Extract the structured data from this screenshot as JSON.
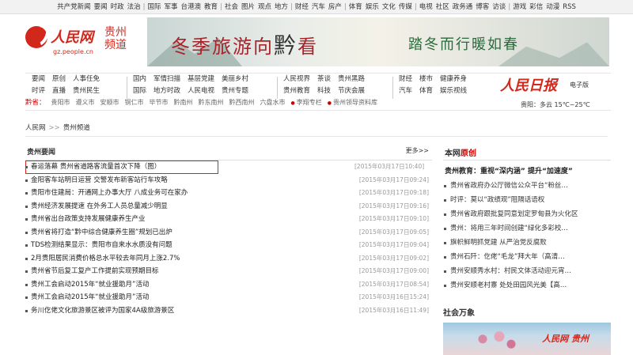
{
  "topnav": [
    "共产党新闻",
    "要闻",
    "时政",
    "法治",
    "国际",
    "军事",
    "台港澳",
    "教育",
    "社会",
    "图片",
    "观点",
    "地方",
    "财经",
    "汽车",
    "房产",
    "体育",
    "娱乐",
    "文化",
    "传媒",
    "电视",
    "社区",
    "政务通",
    "博客",
    "访谈",
    "游戏",
    "彩信",
    "动漫",
    "RSS"
  ],
  "topnav_groups": [
    [
      0,
      1,
      2,
      3
    ],
    [
      4,
      5,
      6,
      7
    ],
    [
      8,
      9,
      10,
      11
    ],
    [
      12,
      13,
      14
    ],
    [
      15,
      16,
      17,
      18
    ],
    [
      19,
      20,
      21,
      22,
      23
    ],
    [
      24,
      25,
      26,
      27
    ]
  ],
  "logo": {
    "name": "人民网",
    "domain": "gz.people.cn",
    "region_line1": "贵州",
    "region_line2": "频道"
  },
  "banner": {
    "text1": "冬季旅游向",
    "text_mid": "黔",
    "text1b": "看",
    "text2": "踏冬而行暖如春"
  },
  "nav2": {
    "col1": [
      [
        "要闻",
        "原创",
        "人事任免"
      ],
      [
        "时评",
        "直播",
        "贵州民生"
      ]
    ],
    "col2": [
      [
        "国内",
        "军情扫描",
        "基层党建",
        "美丽乡村"
      ],
      [
        "国际",
        "地方时政",
        "人民电视",
        "贵州专题"
      ]
    ],
    "col3": [
      [
        "人民视界",
        "茶谈",
        "贵州黑路"
      ],
      [
        "贵州教育",
        "科技",
        "节庆会展"
      ]
    ],
    "col4": [
      [
        "财经",
        "楼市",
        "健康养身"
      ],
      [
        "汽车",
        "体育",
        "娱乐视线"
      ]
    ]
  },
  "cities": {
    "label": "黔省：",
    "items": [
      "贵阳市",
      "遵义市",
      "安顺市",
      "铜仁市",
      "毕节市",
      "黔南州",
      "黔东南州",
      "黔西南州",
      "六盘水市"
    ],
    "extra": [
      "李翔专栏",
      "贵州领导资料库"
    ]
  },
  "rmrb": {
    "logo": "人民日报",
    "sub": "电子版",
    "weather": "贵阳：多云 15℃~25℃"
  },
  "breadcrumb": [
    "人民网",
    "贵州频道"
  ],
  "left": {
    "header": "贵州要闻",
    "more": "更多>>",
    "items": [
      {
        "title": "春运落幕 贵州省道路客流量首次下降（图）",
        "time": "[2015年03月17日10:40]"
      },
      {
        "title": "金阳客车站明日运营 交警发布新客站行车攻略",
        "time": "[2015年03月17日09:24]"
      },
      {
        "title": "贵阳市住建局：开通网上办事大厅 八成业务可在家办",
        "time": "[2015年03月17日09:18]"
      },
      {
        "title": "贵州经济发展提速 在外务工人员总量减少明显",
        "time": "[2015年03月17日09:16]"
      },
      {
        "title": "贵州省出台政策支持发展健康养生产业",
        "time": "[2015年03月17日09:10]"
      },
      {
        "title": "贵州省将打造“黔中综合健康养生圈”规划已出炉",
        "time": "[2015年03月17日09:05]"
      },
      {
        "title": "TDS检测结果显示：贵阳市自来水水质没有问题",
        "time": "[2015年03月17日09:04]"
      },
      {
        "title": "2月贵阳居民消费价格总水平较去年同月上涨2.7%",
        "time": "[2015年03月17日09:02]"
      },
      {
        "title": "贵州省节后复工复产工作提前实现预期目标",
        "time": "[2015年03月17日09:00]"
      },
      {
        "title": "贵州工会启动2015年“就业援助月”活动",
        "time": "[2015年03月17日08:54]"
      },
      {
        "title": "贵州工会启动2015年“就业援助月”活动",
        "time": "[2015年03月16日15:24]"
      },
      {
        "title": "务川仡佬文化旅游景区被评为国家4A级旅游景区",
        "time": "[2015年03月16日11:49]"
      }
    ]
  },
  "right": {
    "header_a": "本网",
    "header_b": "原创",
    "headline": "贵州教育：重视“深内涵” 提升“加速度”",
    "items": [
      "贵州省政府办公厅微信公众平台“粉丝…",
      "时评：莫以“政绩观”阻隔话语权",
      "贵州省政府跟批复同意划定罗甸县为火化区",
      "贵州：将用三年时间创建“绿化多彩校…",
      "旗帜鲜明抓党建 从严治党反腐败",
      "贵州石阡：仡佬“毛龙”拜大年（高清…",
      "贵州安顺秀水村：村民文体活动迎元宵…",
      "贵州安顺老村寨 处处田园风光美【高…"
    ],
    "social_header": "社会万象",
    "social_watermark": "人民网 贵州"
  }
}
